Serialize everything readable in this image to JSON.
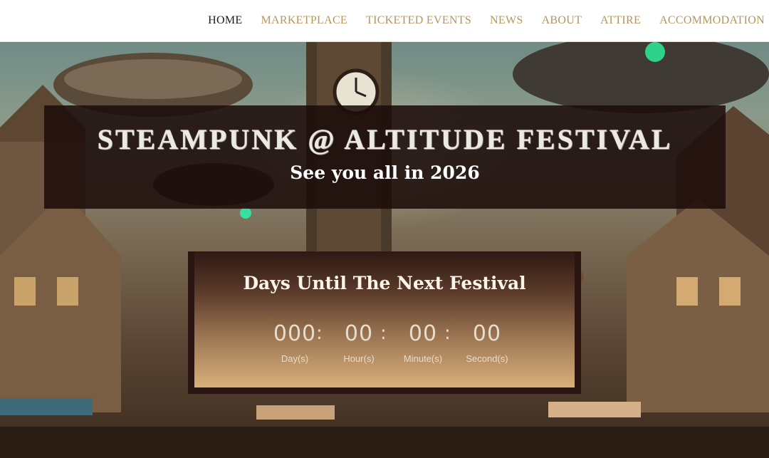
{
  "nav": {
    "items": [
      {
        "label": "HOME",
        "active": true
      },
      {
        "label": "MARKETPLACE",
        "active": false
      },
      {
        "label": "TICKETED EVENTS",
        "active": false
      },
      {
        "label": "NEWS",
        "active": false
      },
      {
        "label": "ABOUT",
        "active": false
      },
      {
        "label": "ATTIRE",
        "active": false
      },
      {
        "label": "ACCOMMODATION",
        "active": false
      }
    ],
    "active_color": "#1c1c1c",
    "inactive_color": "#b3955f"
  },
  "banner": {
    "title": "STEAMPUNK @ ALTITUDE FESTIVAL",
    "subtitle": "See you all in 2026"
  },
  "countdown": {
    "heading": "Days Until The Next Festival",
    "separator": ":",
    "units": [
      {
        "value": "000",
        "label": "Day(s)"
      },
      {
        "value": "00",
        "label": "Hour(s)"
      },
      {
        "value": "00",
        "label": "Minute(s)"
      },
      {
        "value": "00",
        "label": "Second(s)"
      }
    ]
  }
}
